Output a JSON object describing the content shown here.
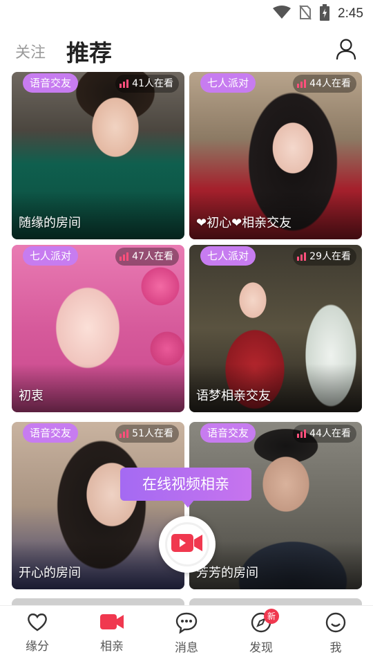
{
  "status_bar": {
    "time": "2:45"
  },
  "header": {
    "tabs": [
      {
        "label": "关注",
        "active": false
      },
      {
        "label": "推荐",
        "active": true
      }
    ]
  },
  "rooms": [
    {
      "tag": "语音交友",
      "viewers": "41人在看",
      "name": "随缘的房间"
    },
    {
      "tag": "七人派对",
      "viewers": "44人在看",
      "name": "❤初心❤相亲交友"
    },
    {
      "tag": "七人派对",
      "viewers": "47人在看",
      "name": "初衷"
    },
    {
      "tag": "七人派对",
      "viewers": "29人在看",
      "name": "语梦相亲交友"
    },
    {
      "tag": "语音交友",
      "viewers": "51人在看",
      "name": "开心的房间"
    },
    {
      "tag": "语音交友",
      "viewers": "44人在看",
      "name": "芳芳的房间"
    }
  ],
  "video_promo": {
    "label": "在线视频相亲"
  },
  "bottom_nav": [
    {
      "label": "缘分",
      "icon": "heart-icon"
    },
    {
      "label": "相亲",
      "icon": "video-camera-icon"
    },
    {
      "label": "消息",
      "icon": "chat-bubble-icon"
    },
    {
      "label": "发现",
      "icon": "compass-icon",
      "badge": "新"
    },
    {
      "label": "我",
      "icon": "smile-icon"
    }
  ],
  "colors": {
    "accent_pink": "#f0384f",
    "tag_purple": "#c77cf0",
    "promo_purple": "#a46af2"
  }
}
